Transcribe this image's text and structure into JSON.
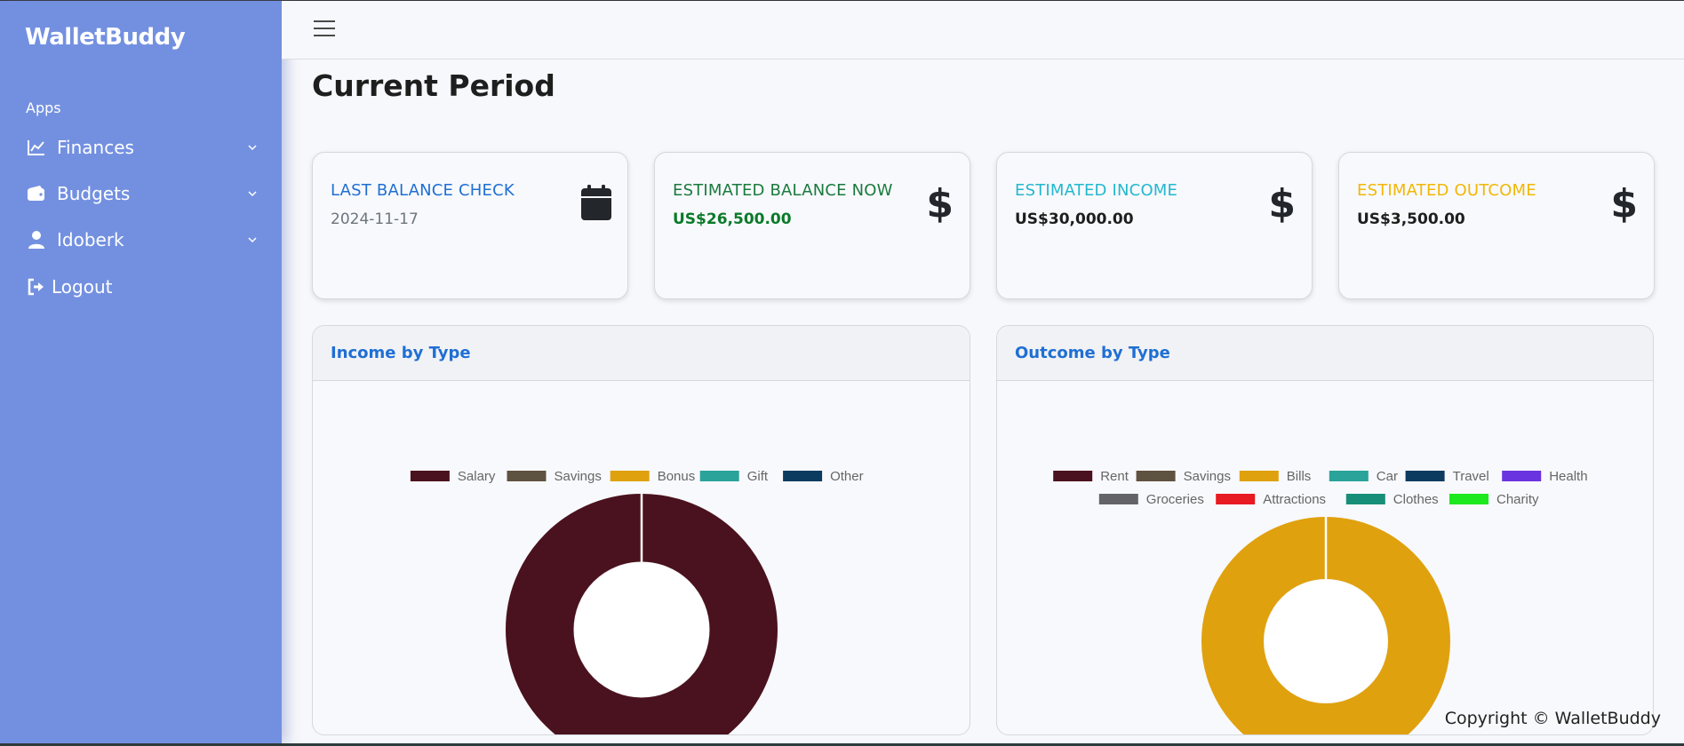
{
  "app": {
    "brand": "WalletBuddy"
  },
  "sidebar": {
    "section_label": "Apps",
    "items": [
      {
        "label": "Finances",
        "icon": "line-chart-icon",
        "has_submenu": true
      },
      {
        "label": "Budgets",
        "icon": "wallet-icon",
        "has_submenu": true
      },
      {
        "label": "Idoberk",
        "icon": "user-icon",
        "has_submenu": true
      },
      {
        "label": "Logout",
        "icon": "logout-icon",
        "has_submenu": false
      }
    ]
  },
  "topbar": {
    "menu_icon": "hamburger-icon"
  },
  "page": {
    "title": "Current Period"
  },
  "cards": [
    {
      "title": "LAST BALANCE CHECK",
      "value": "2024-11-17",
      "icon": "calendar-icon",
      "title_color": "#1f6fd4"
    },
    {
      "title": "ESTIMATED BALANCE NOW",
      "value": "US$26,500.00",
      "icon": "dollar-icon",
      "title_color": "#1a7a3e"
    },
    {
      "title": "ESTIMATED INCOME",
      "value": "US$30,000.00",
      "icon": "dollar-icon",
      "title_color": "#22b8cf"
    },
    {
      "title": "ESTIMATED OUTCOME",
      "value": "US$3,500.00",
      "icon": "dollar-icon",
      "title_color": "#f2b705"
    }
  ],
  "panels": {
    "income": {
      "title": "Income by Type"
    },
    "outcome": {
      "title": "Outcome by Type"
    }
  },
  "chart_data": [
    {
      "type": "pie",
      "title": "Income by Type",
      "categories": [
        "Salary",
        "Savings",
        "Bonus",
        "Gift",
        "Other"
      ],
      "values": [
        30000,
        0,
        0,
        0,
        0
      ],
      "colors": [
        "#4a121e",
        "#5e5241",
        "#e0a10e",
        "#2aa39a",
        "#0b3b5f"
      ],
      "legend": "top"
    },
    {
      "type": "pie",
      "title": "Outcome by Type",
      "categories": [
        "Rent",
        "Savings",
        "Bills",
        "Car",
        "Travel",
        "Health",
        "Groceries",
        "Attractions",
        "Clothes",
        "Charity"
      ],
      "values": [
        0,
        0,
        3500,
        0,
        0,
        0,
        0,
        0,
        0,
        0
      ],
      "colors": [
        "#4a121e",
        "#5e5241",
        "#e0a10e",
        "#2aa39a",
        "#0b3b5f",
        "#6a34e0",
        "#646468",
        "#e81a22",
        "#178f78",
        "#1ee81e"
      ],
      "legend": "top"
    }
  ],
  "footer": {
    "text": "Copyright © WalletBuddy"
  }
}
